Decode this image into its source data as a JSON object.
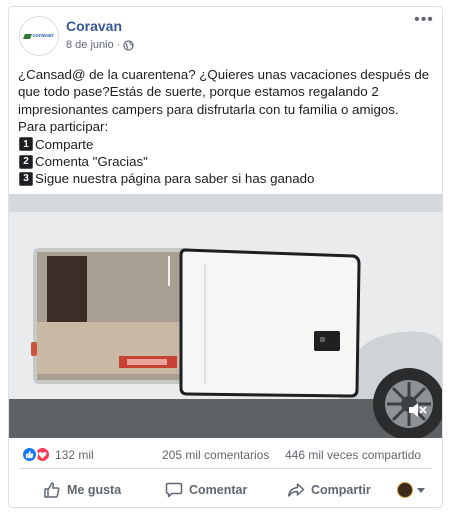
{
  "post": {
    "page_name": "Coravan",
    "avatar_text": "coravan",
    "date": "8 de junio ·",
    "globe_icon": "globe-icon",
    "more_icon": "more-options-icon",
    "text": {
      "line1": "¿Cansad@ de la cuarentena? ¿Quieres unas vacaciones después de",
      "line2": "que todo pase?Estás de suerte, porque estamos regalando 2",
      "line3": "impresionantes campers para disfrutarla con tu familia o amigos.",
      "line4": "Para participar:",
      "steps": [
        {
          "num": "1",
          "label": "Comparte"
        },
        {
          "num": "2",
          "label": "Comenta \"Gracias\""
        },
        {
          "num": "3",
          "label": "Sigue nuestra página para saber si has ganado"
        }
      ]
    },
    "video": {
      "subject": "camper-storage-door",
      "mute_icon": "speaker-muted-icon"
    }
  },
  "stats": {
    "reactions_count": "132 mil",
    "comments": "205 mil comentarios",
    "shares": "446 mil veces compartido"
  },
  "actions": {
    "like": "Me gusta",
    "comment": "Comentar",
    "share": "Compartir"
  },
  "colors": {
    "link_blue": "#385898",
    "like_blue": "#1877f2",
    "love_red": "#f33e58",
    "secondary_text": "#606770"
  }
}
